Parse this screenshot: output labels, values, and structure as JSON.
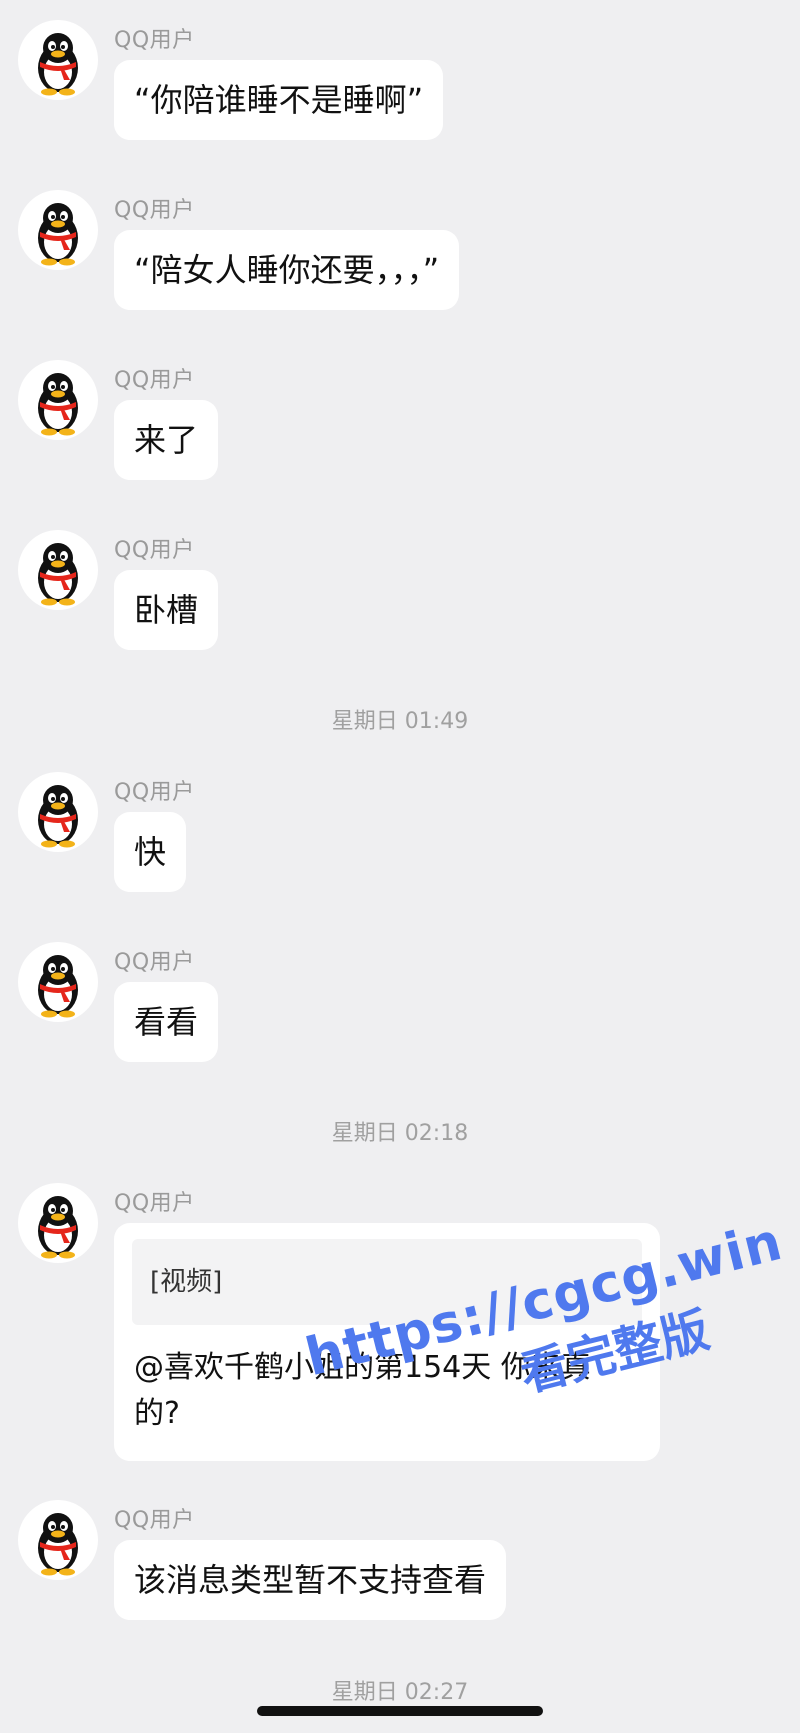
{
  "sender_name": "QQ用户",
  "messages": [
    {
      "text": "“你陪谁睡不是睡啊”"
    },
    {
      "text": "“陪女人睡你还要，，，”"
    },
    {
      "text": "来了"
    },
    {
      "text": "卧槽"
    },
    {
      "text": "快"
    },
    {
      "text": "看看"
    },
    {
      "quote": "[视频]",
      "text_line1": "@喜欢千鹤小姐的第154天 你来真",
      "text_line2": "的?"
    },
    {
      "text": "该消息类型暂不支持查看"
    }
  ],
  "timestamps": [
    "星期日 01:49",
    "星期日 02:18",
    "星期日 02:27"
  ],
  "watermark": {
    "url": "https://cgcg.win",
    "subtitle": "看完整版"
  },
  "colors": {
    "background": "#efeff1",
    "bubble": "#ffffff",
    "watermark": "#4f79ee"
  },
  "avatar_icon": "qq-penguin-icon"
}
